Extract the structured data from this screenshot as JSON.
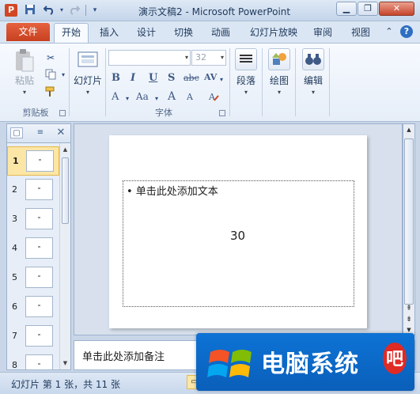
{
  "titlebar": {
    "app_icon": "P",
    "title": "演示文稿2 - Microsoft PowerPoint",
    "qat": {
      "save": "save-icon",
      "undo": "undo-icon",
      "redo": "redo-icon",
      "customize": "qat-customize-icon"
    },
    "window_buttons": {
      "minimize": "▁",
      "restore": "❐",
      "close": "✕"
    }
  },
  "tabs": {
    "file": "文件",
    "items": [
      "开始",
      "插入",
      "设计",
      "切换",
      "动画",
      "幻灯片放映",
      "审阅",
      "视图"
    ],
    "active": "开始"
  },
  "ribbon": {
    "clipboard": {
      "paste": "粘贴",
      "label": "剪贴板"
    },
    "slides": {
      "new_slide": "幻灯片"
    },
    "font": {
      "label": "字体",
      "font_name": "",
      "font_size": "32",
      "buttons": [
        "B",
        "I",
        "U",
        "S",
        "abc",
        "AV",
        "A",
        "Aa",
        "A",
        "A"
      ]
    },
    "paragraph": {
      "label": "段落"
    },
    "drawing": {
      "label": "绘图"
    },
    "editing": {
      "label": "编辑"
    }
  },
  "slides_panel": {
    "tabs": [
      "slides-tab-icon",
      "outline-tab-icon"
    ],
    "close": "✕",
    "thumbnails": [
      "1",
      "2",
      "3",
      "4",
      "5",
      "6",
      "7",
      "8"
    ],
    "selected": "1"
  },
  "slide": {
    "content_placeholder": "• 单击此处添加文本",
    "number": "30"
  },
  "notes": {
    "placeholder": "单击此处添加备注"
  },
  "statusbar": {
    "text": "幻灯片 第 1 张，共 11 张"
  },
  "watermark": {
    "text": "电脑系统",
    "badge": "吧"
  },
  "colors": {
    "file_tab": "#d24625",
    "accent": "#1e395b",
    "selected_thumb": "#fbe6a6",
    "watermark_bg": "#0d73d6"
  }
}
